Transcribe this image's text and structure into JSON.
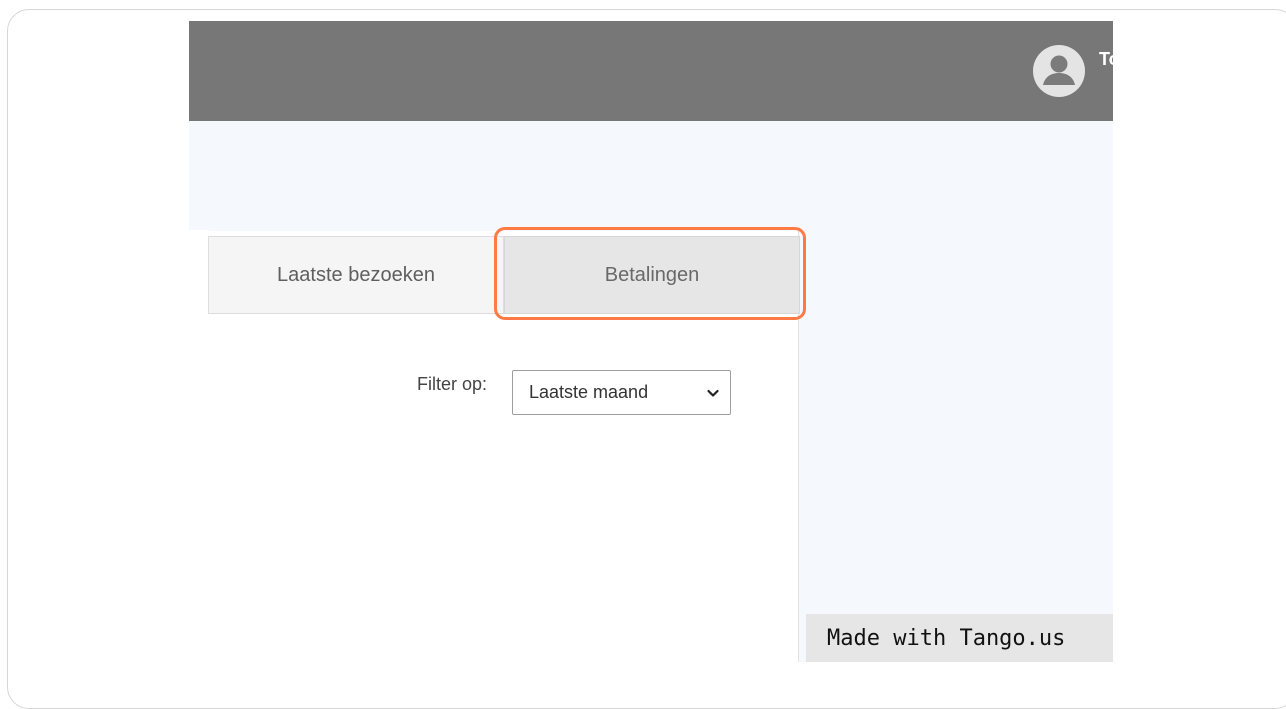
{
  "header": {
    "user_name": "To",
    "avatar_icon": "user-avatar-icon",
    "bar_color": "#777777"
  },
  "tabs": [
    {
      "label": "Laatste bezoeken",
      "active": false
    },
    {
      "label": "Betalingen",
      "active": true
    }
  ],
  "filter": {
    "label": "Filter op:",
    "selected": "Laatste maand",
    "icon": "chevron-down-icon"
  },
  "highlight": {
    "target": "Betalingen",
    "color": "#ff7a45"
  },
  "watermark": {
    "text": "Made with Tango.us"
  }
}
